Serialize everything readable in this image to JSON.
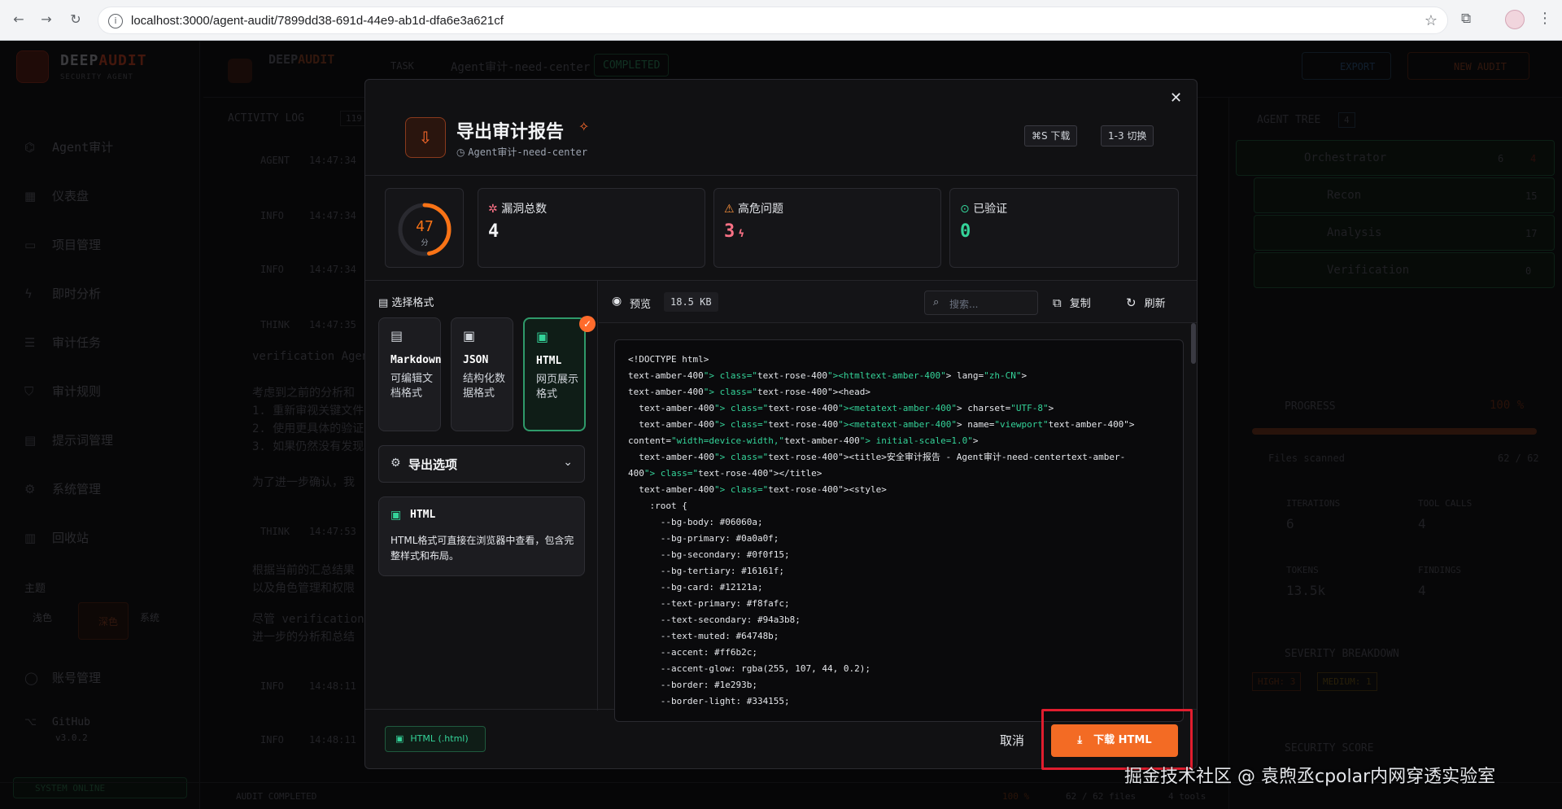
{
  "browser": {
    "url": "localhost:3000/agent-audit/7899dd38-691d-44e9-ab1d-dfa6e3a621cf",
    "back": "←",
    "forward": "→",
    "reload": "↻"
  },
  "app": {
    "logo_title_a": "DEEP",
    "logo_title_b": "AUDIT",
    "logo_sub": "SECURITY AGENT",
    "sidebar": [
      {
        "label": "Agent审计",
        "icon": "bot-icon"
      },
      {
        "label": "仪表盘",
        "icon": "dashboard-icon"
      },
      {
        "label": "项目管理",
        "icon": "folder-icon"
      },
      {
        "label": "即时分析",
        "icon": "bolt-icon"
      },
      {
        "label": "审计任务",
        "icon": "list-icon"
      },
      {
        "label": "审计规则",
        "icon": "shield-icon"
      },
      {
        "label": "提示词管理",
        "icon": "prompt-icon"
      },
      {
        "label": "系统管理",
        "icon": "gear-icon"
      },
      {
        "label": "回收站",
        "icon": "trash-icon"
      }
    ],
    "theme_label": "主题",
    "theme_light": "浅色",
    "theme_dark": "深色",
    "theme_system": "系统",
    "account": "账号管理",
    "github": "GitHub",
    "version": "v3.0.2",
    "system_status": "SYSTEM ONLINE",
    "task_label": "TASK",
    "task_name": "Agent审计-need-center",
    "task_status": "COMPLETED",
    "export_btn": "EXPORT",
    "new_audit_btn": "NEW AUDIT",
    "activity_log": "ACTIVITY LOG",
    "activity_count": "119",
    "log_rows": [
      {
        "tag": "AGENT",
        "time": "14:47:34"
      },
      {
        "tag": "INFO",
        "time": "14:47:34"
      },
      {
        "tag": "INFO",
        "time": "14:47:34"
      },
      {
        "tag": "THINK",
        "time": "14:47:35"
      },
      {
        "tag": "THINK",
        "time": "14:47:53"
      },
      {
        "tag": "INFO",
        "time": "14:48:11"
      },
      {
        "tag": "INFO",
        "time": "14:48:11"
      }
    ],
    "log_text_1": "verification Agent",
    "log_text_2": "考虑到之前的分析和",
    "log_text_3": "1. 重新审视关键文件",
    "log_text_4": "2. 使用更具体的验证",
    "log_text_5": "3. 如果仍然没有发现",
    "log_text_6": "为了进一步确认，我",
    "log_text_7": "根据当前的汇总结果",
    "log_text_8": "以及角色管理和权限",
    "log_text_9": "尽管 verification",
    "log_text_10": "进一步的分析和总结",
    "agent_tree": "AGENT TREE",
    "agent_tree_count": "4",
    "tree": [
      {
        "name": "Orchestrator",
        "stat": "6",
        "stat2": "4"
      },
      {
        "name": "Recon",
        "stat": "15"
      },
      {
        "name": "Analysis",
        "stat": "17"
      },
      {
        "name": "Verification",
        "stat": "0"
      }
    ],
    "progress_label": "PROGRESS",
    "progress_value": "100 %",
    "progress_fraction": 1.0,
    "files_scanned_label": "Files scanned",
    "files_scanned": "62 / 62",
    "iterations_label": "ITERATIONS",
    "iterations": "6",
    "tool_calls_label": "TOOL CALLS",
    "tool_calls": "4",
    "tokens_label": "TOKENS",
    "tokens": "13.5k",
    "findings_label": "FINDINGS",
    "findings": "4",
    "severity_label": "SEVERITY BREAKDOWN",
    "sev_high": "HIGH: 3",
    "sev_medium": "MEDIUM: 1",
    "security_score_label": "SECURITY SCORE",
    "status_audit": "AUDIT COMPLETED",
    "status_pct": "100 %",
    "status_files": "62 / 62 files",
    "status_tools": "4 tools"
  },
  "modal": {
    "title": "导出审计报告",
    "subtitle": "Agent审计-need-center",
    "kbd_download": "⌘S 下载",
    "kbd_switch": "1-3 切换",
    "score": "47",
    "score_unit": "分",
    "score_fraction": 0.47,
    "stats": [
      {
        "label": "漏洞总数",
        "value": "4",
        "color": "#f3f4f6"
      },
      {
        "label": "高危问题",
        "value": "3",
        "color": "#fb7185"
      },
      {
        "label": "已验证",
        "value": "0",
        "color": "#34d399"
      }
    ],
    "choose_format": "选择格式",
    "formats": [
      {
        "name": "Markdown",
        "desc": "可编辑文档格式"
      },
      {
        "name": "JSON",
        "desc": "结构化数据格式"
      },
      {
        "name": "HTML",
        "desc": "网页展示格式"
      }
    ],
    "export_options": "导出选项",
    "desc_title": "HTML",
    "desc_text": "HTML格式可直接在浏览器中查看，包含完整样式和布局。",
    "preview_label": "预览",
    "file_size": "18.5 KB",
    "search_placeholder": "搜索...",
    "copy": "复制",
    "refresh": "刷新",
    "footer_badge": "HTML (.html)",
    "cancel": "取消",
    "download": "下载 HTML",
    "code_lines": [
      "<!DOCTYPE html>",
      "text-amber-400\"> class=\"text-rose-400\"><htmltext-amber-400\"> lang=\"zh-CN\">",
      "text-amber-400\"> class=\"text-rose-400\"><head>",
      "  text-amber-400\"> class=\"text-rose-400\"><metatext-amber-400\"> charset=\"UTF-8\">",
      "  text-amber-400\"> class=\"text-rose-400\"><metatext-amber-400\"> name=\"viewport\"text-amber-400\">",
      "content=\"width=device-width,\"text-amber-400\"> initial-scale=1.0\">",
      "  text-amber-400\"> class=\"text-rose-400\"><title>安全审计报告 - Agent审计-need-centertext-amber-",
      "400\"> class=\"text-rose-400\"></title>",
      "  text-amber-400\"> class=\"text-rose-400\"><style>",
      "    :root {",
      "      --bg-body: #06060a;",
      "      --bg-primary: #0a0a0f;",
      "      --bg-secondary: #0f0f15;",
      "      --bg-tertiary: #16161f;",
      "      --bg-card: #12121a;",
      "      --text-primary: #f8fafc;",
      "      --text-secondary: #94a3b8;",
      "      --text-muted: #64748b;",
      "      --accent: #ff6b2c;",
      "      --accent-glow: rgba(255, 107, 44, 0.2);",
      "      --border: #1e293b;",
      "      --border-light: #334155;"
    ]
  },
  "watermark": "掘金技术社区 @ 袁煦丞cpolar内网穿透实验室"
}
